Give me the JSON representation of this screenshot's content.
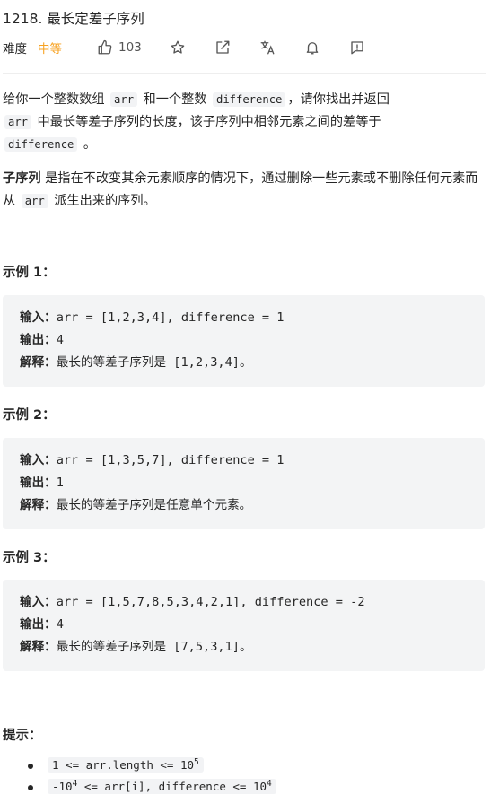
{
  "title": "1218. 最长定差子序列",
  "meta": {
    "difficulty_label": "难度",
    "difficulty_value": "中等",
    "likes": "103"
  },
  "description": {
    "p1_a": "给你一个整数数组 ",
    "p1_code1": "arr",
    "p1_b": " 和一个整数 ",
    "p1_code2": "difference",
    "p1_c": "，请你找出并返回",
    "p1_code3": "arr",
    "p1_d": " 中最长等差子序列的长度，该子序列中相邻元素之间的差等于",
    "p1_code4": "difference",
    "p1_e": " 。",
    "p2_bold": "子序列",
    "p2_a": " 是指在不改变其余元素顺序的情况下，通过删除一些元素或不删除任何元素而从 ",
    "p2_code": "arr",
    "p2_b": " 派生出来的序列。"
  },
  "examples": [
    {
      "heading": "示例 1：",
      "input_label": "输入：",
      "input": "arr = [1,2,3,4], difference = 1",
      "output_label": "输出：",
      "output": "4",
      "explain_label": "解释：",
      "explain": "最长的等差子序列是 [1,2,3,4]。"
    },
    {
      "heading": "示例 2：",
      "input_label": "输入：",
      "input": "arr = [1,3,5,7], difference = 1",
      "output_label": "输出：",
      "output": "1",
      "explain_label": "解释：",
      "explain": "最长的等差子序列是任意单个元素。"
    },
    {
      "heading": "示例 3：",
      "input_label": "输入：",
      "input": "arr = [1,5,7,8,5,3,4,2,1], difference = -2",
      "output_label": "输出：",
      "output": "4",
      "explain_label": "解释：",
      "explain": "最长的等差子序列是 [7,5,3,1]。"
    }
  ],
  "hints": {
    "heading": "提示：",
    "items": [
      {
        "pre": "1 <= arr.length <= 10",
        "sup": "5",
        "mid": "",
        "sup2": ""
      },
      {
        "pre": "-10",
        "sup": "4",
        "mid": " <= arr[i], difference <= 10",
        "sup2": "4"
      }
    ]
  },
  "icons": [
    "thumbs-up-icon",
    "star-icon",
    "share-icon",
    "translate-icon",
    "bell-icon",
    "feedback-icon"
  ],
  "colors": {
    "difficulty_medium": "#f7a221",
    "code_bg": "#f3f4f5"
  }
}
